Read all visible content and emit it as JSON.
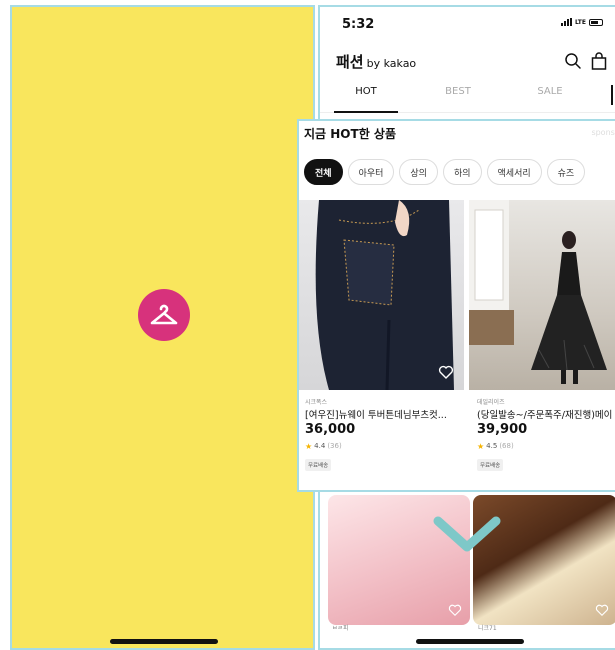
{
  "splash": {
    "logo_icon": "hanger-icon",
    "background": "#f9e65d",
    "logo_color": "#d7327c"
  },
  "status_bar": {
    "time": "5:32",
    "network": "LTE"
  },
  "header": {
    "title": "패션",
    "subtitle": "by kakao",
    "search_icon": "search-icon",
    "bag_icon": "shopping-bag-icon"
  },
  "tabs": [
    {
      "label": "HOT",
      "active": true
    },
    {
      "label": "BEST",
      "active": false
    },
    {
      "label": "SALE",
      "active": false
    }
  ],
  "popup": {
    "title": "지금 HOT한 상품",
    "sponsor": "sponsor",
    "chips": [
      {
        "label": "전체",
        "active": true
      },
      {
        "label": "아우터",
        "active": false
      },
      {
        "label": "상의",
        "active": false
      },
      {
        "label": "하의",
        "active": false
      },
      {
        "label": "액세서리",
        "active": false
      },
      {
        "label": "슈즈",
        "active": false
      }
    ],
    "products": [
      {
        "brand": "시크폭스",
        "name": "[여우진]뉴웨이 투버튼데님부츠컷...",
        "price": "36,000",
        "rating": "4.4",
        "reviews": "(36)",
        "badge": "무료배송"
      },
      {
        "brand": "데일리이즈",
        "name": "(당일발송~/주문폭주/재진행)메이",
        "price": "39,900",
        "rating": "4.5",
        "reviews": "(68)",
        "badge": "무료배송"
      }
    ]
  },
  "peek_labels": [
    "ㅂㄹ피",
    "니크71"
  ],
  "accent": "#7ec8c8"
}
